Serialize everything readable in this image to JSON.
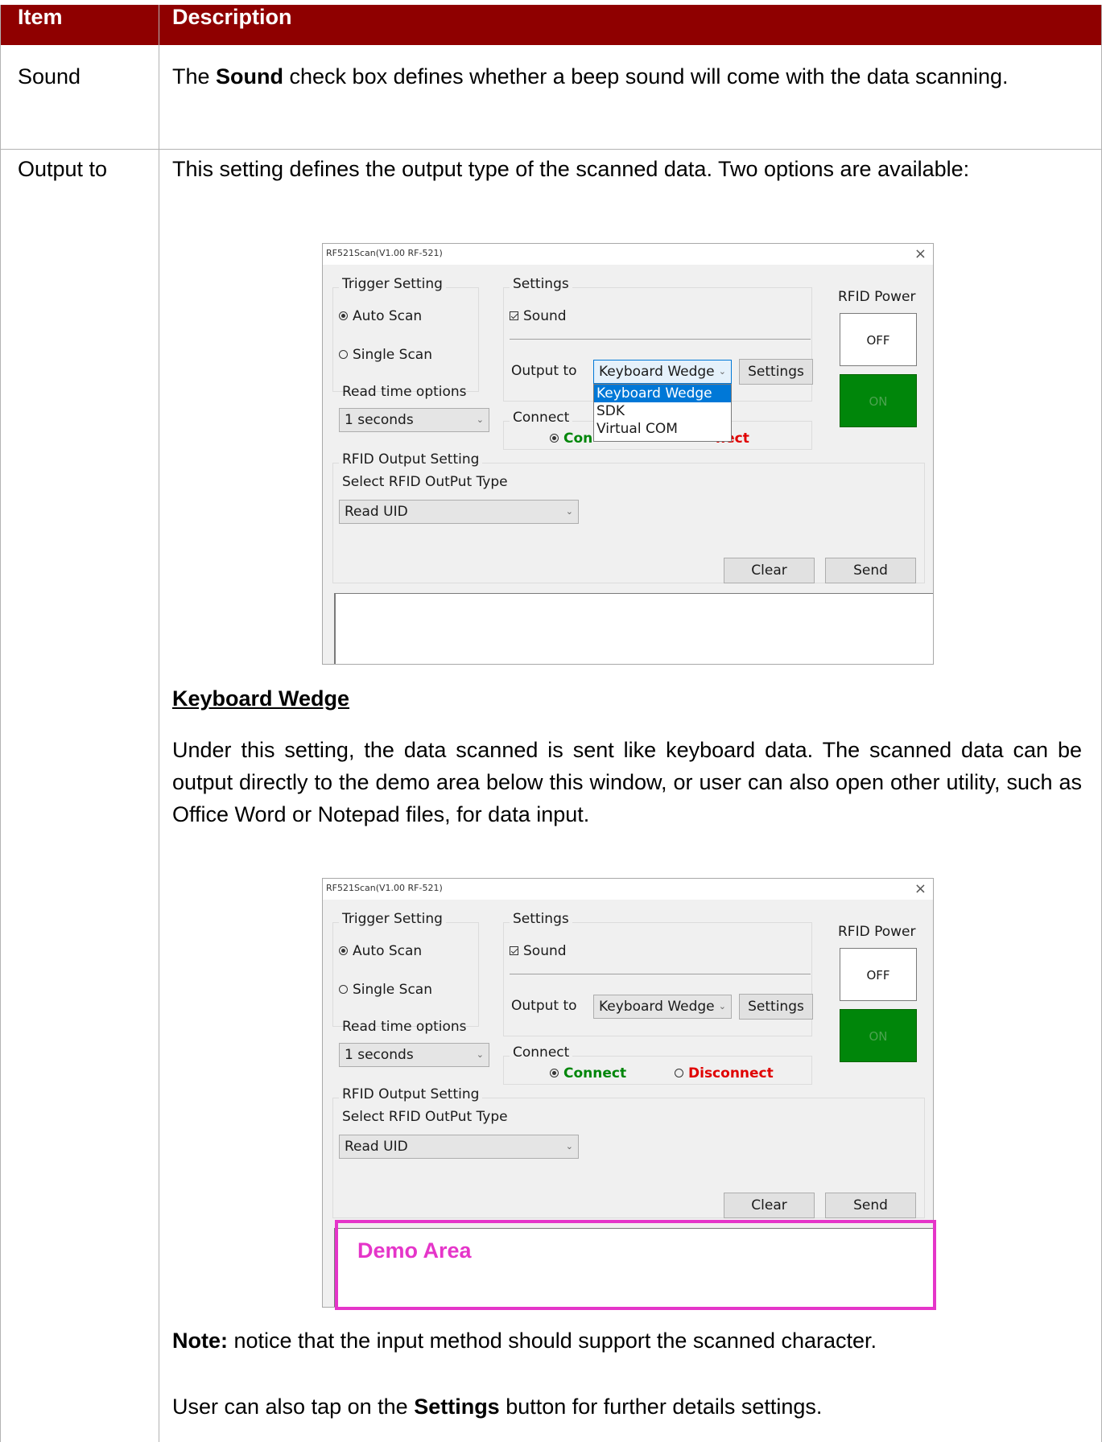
{
  "table": {
    "headers": [
      "Item",
      "Description"
    ],
    "rows": [
      {
        "item": "Sound",
        "desc_parts": [
          "The ",
          "Sound",
          " check box defines whether a beep sound will come with the data scanning."
        ]
      },
      {
        "item": "Output to",
        "intro": "This setting defines the output type of the scanned data. Two options are available:",
        "subheading": "Keyboard Wedge",
        "paragraph": "Under this setting, the data scanned is sent like keyboard data. The scanned data can be output directly to the demo area below this window, or user can also open other utility, such as Office Word or Notepad files, for data input.",
        "note_label": "Note:",
        "note_text": " notice that the input method should support the scanned character.",
        "settings_parts": [
          "User can also tap on the ",
          "Settings",
          " button for further details settings."
        ]
      }
    ]
  },
  "app": {
    "title": "RF521Scan(V1.00 RF-521)",
    "close_glyph": "×",
    "trigger_group": "Trigger Setting",
    "auto_scan": "Auto Scan",
    "single_scan": "Single Scan",
    "read_time_label": "Read time options",
    "read_time_value": "1 seconds",
    "settings_group": "Settings",
    "sound_label": "Sound",
    "output_label": "Output to",
    "output_value": "Keyboard Wedge",
    "settings_button": "Settings",
    "connect_group": "Connect",
    "connect_option": "Connect",
    "disconnect_option": "Disconnect",
    "rfid_power_label": "RFID Power",
    "off_button": "OFF",
    "on_button": "ON",
    "rfid_output_group": "RFID Output Setting",
    "rfid_type_label": "Select RFID OutPut Type",
    "rfid_type_value": "Read UID",
    "clear_button": "Clear",
    "send_button": "Send",
    "dropdown_options": [
      "Keyboard Wedge",
      "SDK",
      "Virtual COM"
    ],
    "dropdown_selected": "Keyboard Wedge",
    "connect_partial": "Con",
    "disconnect_partial": "nect",
    "dropdown_arrow": "⌄",
    "demo_area_label": "Demo Area"
  },
  "colors": {
    "header_bg": "#8f0000",
    "connect": "#00860a",
    "disconnect": "#e00000",
    "on_button": "#00860a",
    "demo_highlight": "#e535c9",
    "dropdown_selection": "#0078d7"
  }
}
